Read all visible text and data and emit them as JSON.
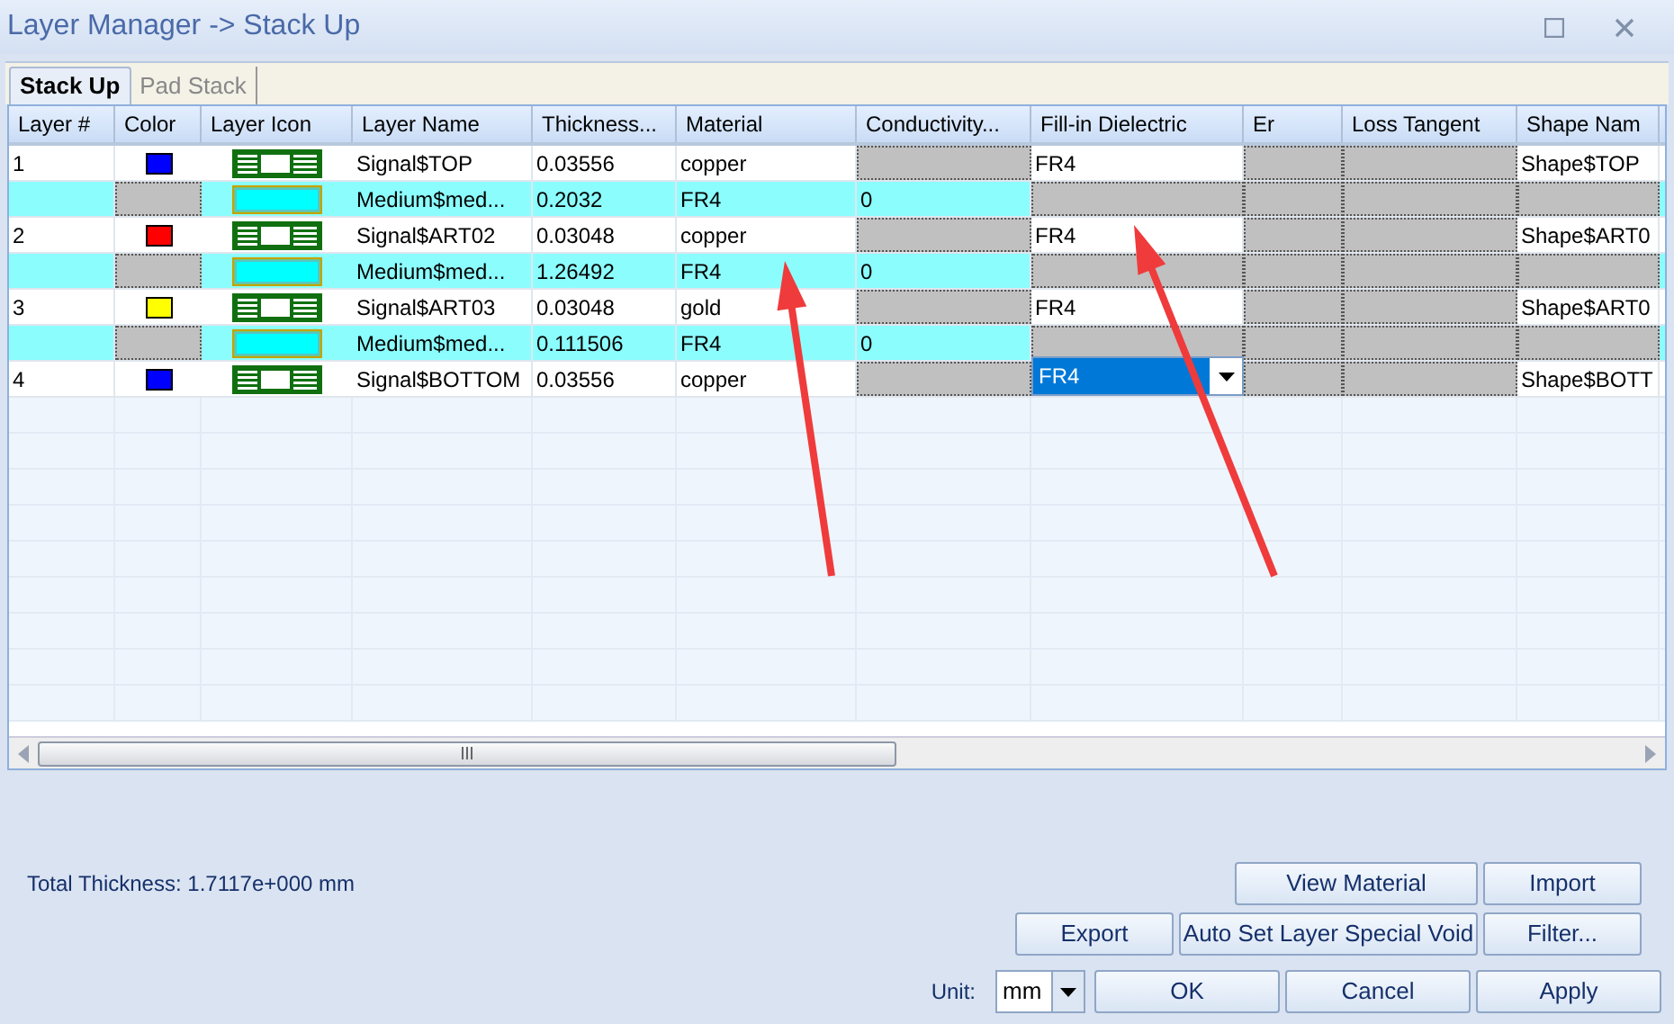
{
  "window": {
    "title": "Layer Manager -> Stack Up"
  },
  "tabs": [
    {
      "label": "Stack Up",
      "selected": true
    },
    {
      "label": "Pad Stack",
      "selected": false
    }
  ],
  "table": {
    "columns": [
      "Layer #",
      "Color",
      "Layer Icon",
      "Layer Name",
      "Thickness...",
      "Material",
      "Conductivity...",
      "Fill-in Dielectric",
      "Er",
      "Loss Tangent",
      "Shape Nam"
    ],
    "rows": [
      {
        "kind": "signal",
        "number": "1",
        "color": "#0000ff",
        "name": "Signal$TOP",
        "thickness": "0.03556",
        "material": "copper",
        "fill_in": "FR4",
        "fill_editing": false,
        "shape": "Shape$TOP"
      },
      {
        "kind": "medium",
        "name": "Medium$med...",
        "thickness": "0.2032",
        "material": "FR4",
        "conductivity": "0"
      },
      {
        "kind": "signal",
        "number": "2",
        "color": "#ff0000",
        "name": "Signal$ART02",
        "thickness": "0.03048",
        "material": "copper",
        "fill_in": "FR4",
        "fill_editing": false,
        "shape": "Shape$ART0"
      },
      {
        "kind": "medium",
        "name": "Medium$med...",
        "thickness": "1.26492",
        "material": "FR4",
        "conductivity": "0"
      },
      {
        "kind": "signal",
        "number": "3",
        "color": "#ffff00",
        "name": "Signal$ART03",
        "thickness": "0.03048",
        "material": "gold",
        "fill_in": "FR4",
        "fill_editing": false,
        "shape": "Shape$ART0"
      },
      {
        "kind": "medium",
        "name": "Medium$med...",
        "thickness": "0.111506",
        "material": "FR4",
        "conductivity": "0"
      },
      {
        "kind": "signal",
        "number": "4",
        "color": "#0000ff",
        "name": "Signal$BOTTOM",
        "thickness": "0.03556",
        "material": "copper",
        "fill_in": "FR4",
        "fill_editing": true,
        "shape": "Shape$BOTT"
      }
    ]
  },
  "total_thickness": "Total Thickness: 1.7117e+000 mm",
  "buttons_row1": [
    "View Material",
    "Import"
  ],
  "buttons_row2": [
    "Export",
    "Auto Set Layer Special Void",
    "Filter..."
  ],
  "unit": {
    "label": "Unit:",
    "value": "mm"
  },
  "dialog_buttons": [
    "OK",
    "Cancel",
    "Apply"
  ]
}
